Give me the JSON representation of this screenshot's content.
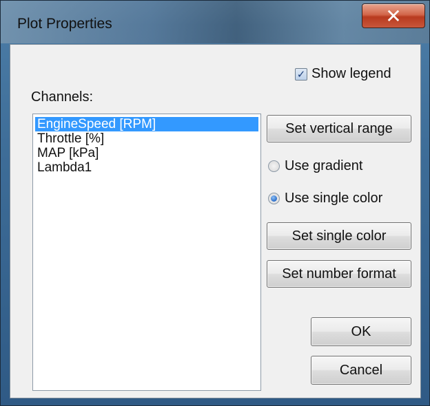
{
  "window": {
    "title": "Plot Properties",
    "close_glyph": "✕"
  },
  "legend": {
    "label": "Show legend",
    "checked": true,
    "check_glyph": "✓"
  },
  "channels": {
    "label": "Channels:",
    "items": [
      {
        "label": "EngineSpeed [RPM]",
        "selected": true
      },
      {
        "label": "Throttle [%]",
        "selected": false
      },
      {
        "label": "MAP [kPa]",
        "selected": false
      },
      {
        "label": "Lambda1",
        "selected": false
      }
    ]
  },
  "buttons": {
    "set_vertical_range": "Set vertical range",
    "set_single_color": "Set single color",
    "set_number_format": "Set number format",
    "ok": "OK",
    "cancel": "Cancel"
  },
  "color_mode": {
    "options": [
      {
        "label": "Use gradient",
        "checked": false
      },
      {
        "label": "Use single color",
        "checked": true
      }
    ]
  },
  "colors": {
    "selection": "#3399ff",
    "close_button": "#c8573c"
  }
}
